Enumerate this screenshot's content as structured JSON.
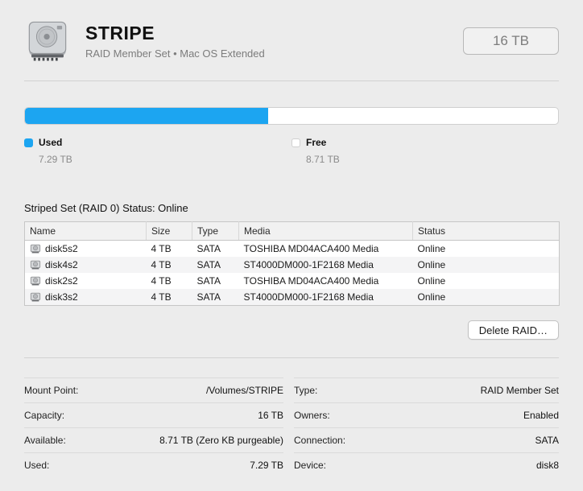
{
  "header": {
    "title": "STRIPE",
    "subtitle": "RAID Member Set • Mac OS Extended",
    "size_badge": "16 TB"
  },
  "usage": {
    "used_label": "Used",
    "used_value": "7.29 TB",
    "free_label": "Free",
    "free_value": "8.71 TB",
    "used_percent": 45.6,
    "used_color": "#1ca5f1"
  },
  "raid": {
    "status_label": "Striped Set (RAID 0) Status: Online",
    "table": {
      "columns": [
        "Name",
        "Size",
        "Type",
        "Media",
        "Status"
      ],
      "rows": [
        {
          "name": "disk5s2",
          "size": "4 TB",
          "type": "SATA",
          "media": "TOSHIBA MD04ACA400 Media",
          "status": "Online"
        },
        {
          "name": "disk4s2",
          "size": "4 TB",
          "type": "SATA",
          "media": "ST4000DM000-1F2168 Media",
          "status": "Online"
        },
        {
          "name": "disk2s2",
          "size": "4 TB",
          "type": "SATA",
          "media": "TOSHIBA MD04ACA400 Media",
          "status": "Online"
        },
        {
          "name": "disk3s2",
          "size": "4 TB",
          "type": "SATA",
          "media": "ST4000DM000-1F2168 Media",
          "status": "Online"
        }
      ]
    },
    "delete_button": "Delete RAID…"
  },
  "info": {
    "left": [
      {
        "label": "Mount Point:",
        "value": "/Volumes/STRIPE"
      },
      {
        "label": "Capacity:",
        "value": "16 TB"
      },
      {
        "label": "Available:",
        "value": "8.71 TB (Zero KB purgeable)"
      },
      {
        "label": "Used:",
        "value": "7.29 TB"
      }
    ],
    "right": [
      {
        "label": "Type:",
        "value": "RAID Member Set"
      },
      {
        "label": "Owners:",
        "value": "Enabled"
      },
      {
        "label": "Connection:",
        "value": "SATA"
      },
      {
        "label": "Device:",
        "value": "disk8"
      }
    ]
  }
}
